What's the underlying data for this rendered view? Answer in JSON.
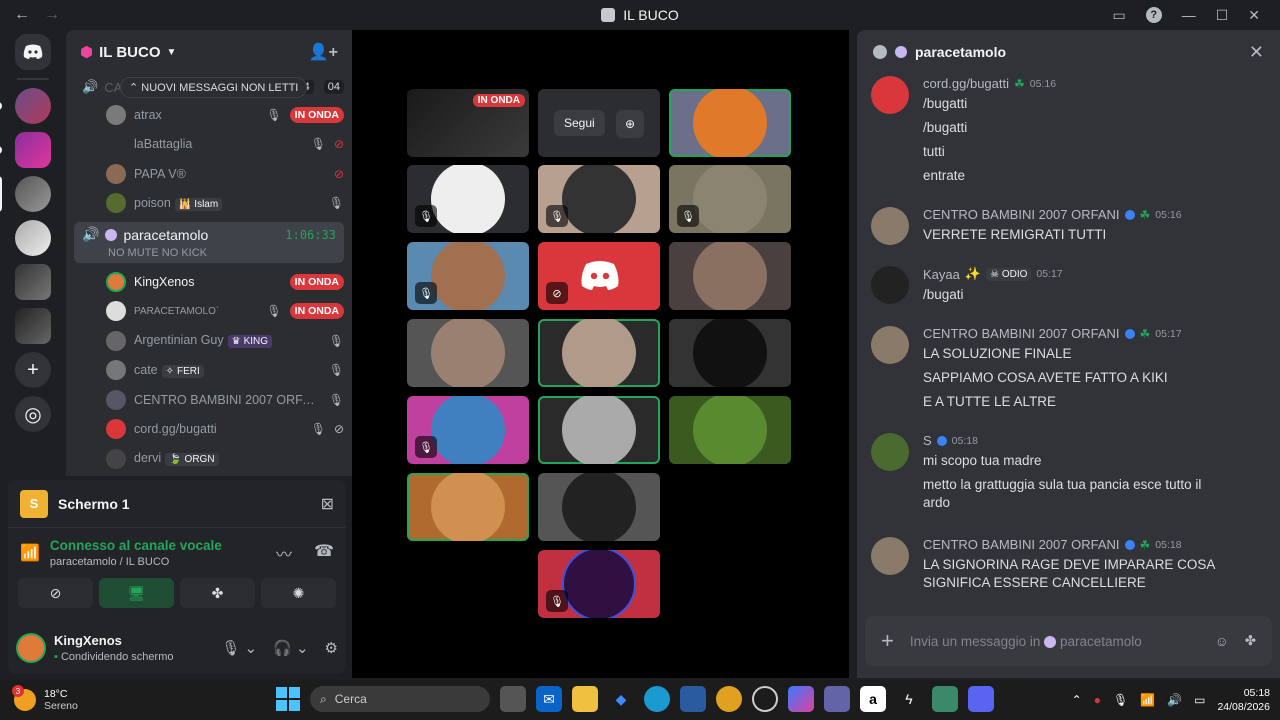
{
  "window": {
    "title": "IL BUCO",
    "back": "←",
    "forward": "→"
  },
  "guild": {
    "name": "IL BUCO"
  },
  "voice": {
    "channel_partial": "CANILE",
    "counts": [
      "04",
      "04"
    ],
    "new_messages": "NUOVI MESSAGGI NON LETTI",
    "users_top": [
      {
        "name": "atrax",
        "live": "IN ONDA"
      },
      {
        "name": "laBattaglia"
      },
      {
        "name": "PAPA V®"
      },
      {
        "name": "poison",
        "tag": "Islam"
      }
    ],
    "selected_channel": {
      "name": "paracetamolo",
      "timer": "1:06:33",
      "topic": "NO MUTE NO KICK"
    },
    "users": [
      {
        "name": "KingXenos",
        "live": "IN ONDA"
      },
      {
        "name": "PARACETAMOLO`",
        "live": "IN ONDA"
      },
      {
        "name": "Argentinian Guy",
        "tag": "KING"
      },
      {
        "name": "cate",
        "tag": "FERI"
      },
      {
        "name": "CENTRO BAMBINI 2007 ORFA..."
      },
      {
        "name": "cord.gg/bugatti"
      },
      {
        "name": "dervi",
        "tag": "ORGN"
      }
    ]
  },
  "panel": {
    "screen_letter": "S",
    "screen_label": "Schermo 1",
    "connected": "Connesso al canale vocale",
    "connected_sub": "paracetamolo / IL BUCO"
  },
  "user": {
    "name": "KingXenos",
    "status": "Condividendo schermo"
  },
  "stage": {
    "live_badge": "IN ONDA",
    "follow": "Segui"
  },
  "chat": {
    "channel": "paracetamolo",
    "composer_placeholder": "Invia un messaggio in",
    "composer_channel": "paracetamolo",
    "messages": [
      {
        "author": "cord.gg/bugatti",
        "time": "05:16",
        "lines": [
          "/bugatti",
          "/bugatti",
          "tutti",
          "entrate"
        ]
      },
      {
        "author": "CENTRO BAMBINI 2007 ORFANI",
        "time": "05:16",
        "lines": [
          "VERRETE REMIGRATI TUTTI"
        ]
      },
      {
        "author": "Kayaa",
        "role": "ODIO",
        "time": "05:17",
        "lines": [
          "/bugati"
        ]
      },
      {
        "author": "CENTRO BAMBINI 2007 ORFANI",
        "time": "05:17",
        "lines": [
          "LA SOLUZIONE FINALE",
          "SAPPIAMO COSA AVETE FATTO A KIKI",
          "E A TUTTE LE ALTRE"
        ]
      },
      {
        "author": "S",
        "time": "05:18",
        "lines": [
          "mi scopo tua madre",
          "metto la grattuggia sula tua pancia esce tutto il ardo"
        ]
      },
      {
        "author": "CENTRO BAMBINI 2007 ORFANI",
        "time": "05:18",
        "lines": [
          "LA SIGNORINA RAGE DEVE IMPARARE COSA SIGNIFICA ESSERE CANCELLIERE"
        ]
      }
    ]
  },
  "taskbar": {
    "temp": "18°C",
    "weather": "Sereno",
    "weather_badge": "3",
    "search": "Cerca",
    "time": "05:18",
    "date": "24/08/2026"
  },
  "colors": {
    "accent_green": "#23a55a",
    "live_red": "#da373c",
    "blurple": "#5865f2"
  }
}
